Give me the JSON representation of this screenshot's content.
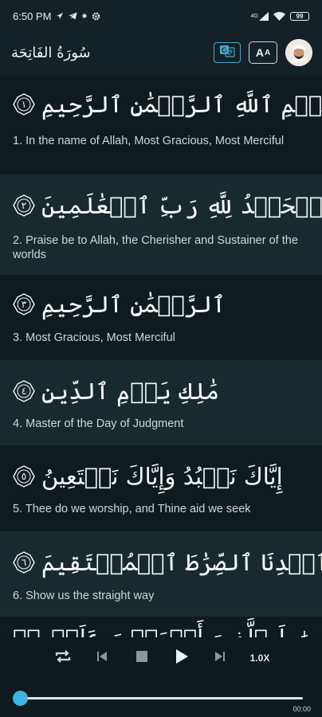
{
  "status_bar": {
    "time": "6:50 PM",
    "network": "4G",
    "battery": "99",
    "icons": [
      "location-icon",
      "telegram-icon",
      "dot-icon",
      "settings-icon",
      "signal-icon",
      "wifi-icon",
      "battery-icon"
    ]
  },
  "header": {
    "surah_title": "سُورَةُ الفَاتِحَة",
    "translate_icon": "translate-icon",
    "font_button": {
      "big": "A",
      "small": "A"
    },
    "avatar_icon": "reciter-avatar"
  },
  "verses": [
    {
      "arabic": "بِسۡمِ ٱللَّهِ ٱلرَّحۡمَٰنِ ٱلرَّحِيمِ",
      "ayah": "١",
      "translation": "1. In the name of Allah, Most Gracious, Most Merciful"
    },
    {
      "arabic": "ٱلۡحَمۡدُ لِلَّهِ رَبِّ ٱلۡعَٰلَمِينَ",
      "ayah": "٢",
      "translation": "2. Praise be to Allah, the Cherisher and Sustainer of the worlds"
    },
    {
      "arabic": "ٱلرَّحۡمَٰنِ ٱلرَّحِيمِ",
      "ayah": "٣",
      "translation": "3. Most Gracious, Most Merciful"
    },
    {
      "arabic": "مَٰلِكِ يَوۡمِ ٱلدِّينِ",
      "ayah": "٤",
      "translation": "4. Master of the Day of Judgment"
    },
    {
      "arabic": "إِيَّاكَ نَعۡبُدُ وَإِيَّاكَ نَسۡتَعِينُ",
      "ayah": "٥",
      "translation": "5. Thee do we worship, and Thine aid we seek"
    },
    {
      "arabic": "ٱهۡدِنَا ٱلصِّرَٰطَ ٱلۡمُسۡتَقِيمَ",
      "ayah": "٦",
      "translation": "6. Show us the straight way"
    },
    {
      "arabic": "صِرَٰطَ ٱلَّذِينَ أَنۡعَمۡتَ عَلَيۡهِمۡ",
      "ayah": "",
      "translation": ""
    }
  ],
  "player": {
    "repeat_icon": "repeat-icon",
    "prev_icon": "skip-previous-icon",
    "stop_icon": "stop-icon",
    "play_icon": "play-icon",
    "next_icon": "skip-next-icon",
    "speed": "1.0X",
    "time": "00:00",
    "progress": 0,
    "accent": "#39b6e6"
  }
}
